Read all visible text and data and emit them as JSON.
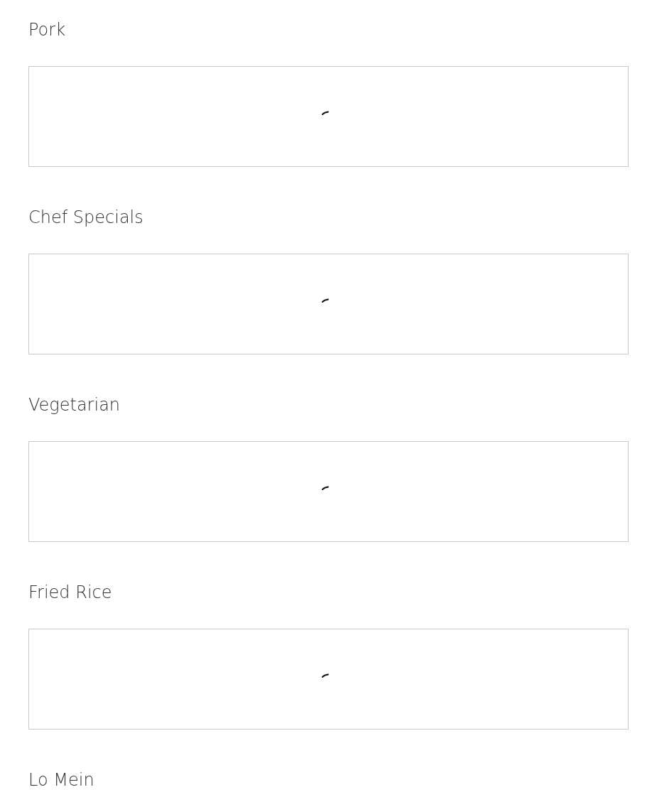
{
  "sections": [
    {
      "title": "Pork"
    },
    {
      "title": "Chef Specials"
    },
    {
      "title": "Vegetarian"
    },
    {
      "title": "Fried Rice"
    },
    {
      "title": "Lo Mein"
    }
  ]
}
